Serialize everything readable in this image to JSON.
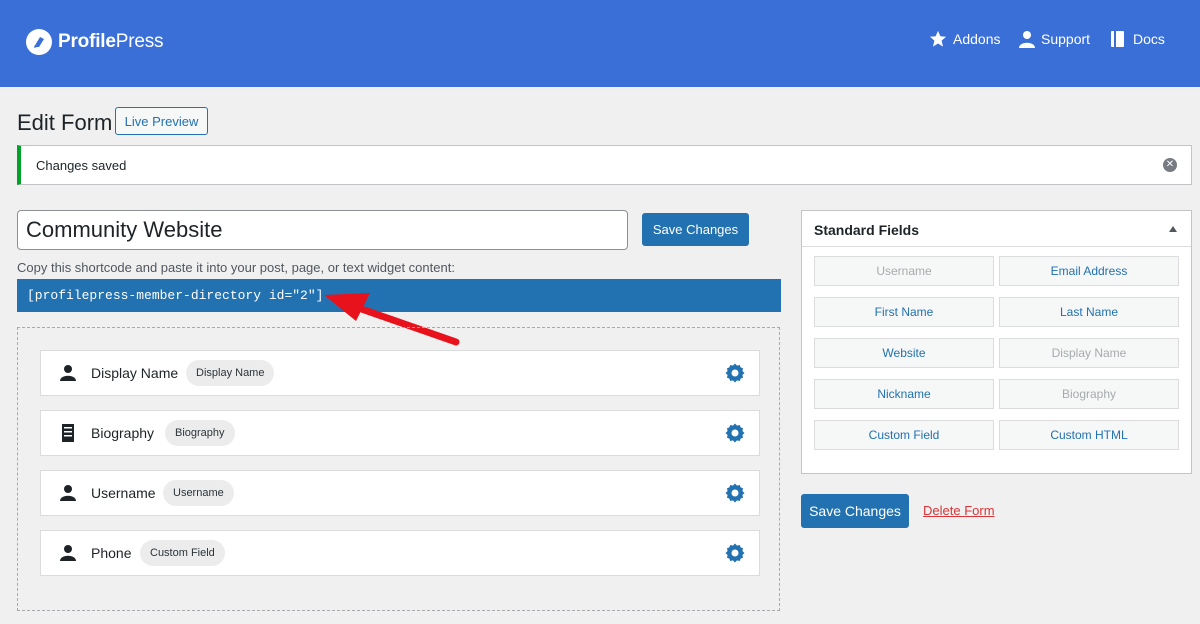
{
  "header": {
    "logo_bold": "Profile",
    "logo_rest": "Press",
    "nav": [
      {
        "label": "Addons",
        "icon": "star-icon"
      },
      {
        "label": "Support",
        "icon": "user-icon"
      },
      {
        "label": "Docs",
        "icon": "book-icon"
      }
    ]
  },
  "page": {
    "title": "Edit Form",
    "live_preview_label": "Live Preview"
  },
  "notice": {
    "text": "Changes saved",
    "close_icon": "close-icon"
  },
  "form": {
    "title_value": "Community Website",
    "save_label": "Save Changes",
    "shortcode_hint": "Copy this shortcode and paste it into your post, page, or text widget content:",
    "shortcode": "[profilepress-member-directory id=\"2\"]"
  },
  "fields": [
    {
      "label": "Display Name",
      "pill": "Display Name",
      "icon": "user-icon"
    },
    {
      "label": "Biography",
      "pill": "Biography",
      "icon": "document-icon"
    },
    {
      "label": "Username",
      "pill": "Username",
      "icon": "user-icon"
    },
    {
      "label": "Phone",
      "pill": "Custom Field",
      "icon": "user-icon"
    }
  ],
  "sidebar": {
    "title": "Standard Fields",
    "buttons": [
      {
        "label": "Username",
        "state": "disabled"
      },
      {
        "label": "Email Address",
        "state": "active"
      },
      {
        "label": "First Name",
        "state": "active"
      },
      {
        "label": "Last Name",
        "state": "active"
      },
      {
        "label": "Website",
        "state": "active"
      },
      {
        "label": "Display Name",
        "state": "disabled"
      },
      {
        "label": "Nickname",
        "state": "active"
      },
      {
        "label": "Biography",
        "state": "disabled"
      },
      {
        "label": "Custom Field",
        "state": "active"
      },
      {
        "label": "Custom HTML",
        "state": "active"
      }
    ],
    "save_label": "Save Changes",
    "delete_label": "Delete Form"
  },
  "colors": {
    "header_bg": "#3a6fd8",
    "accent": "#2271b1",
    "notice_success": "#00a32a",
    "delete": "#d63638",
    "arrow": "#e8121c"
  }
}
